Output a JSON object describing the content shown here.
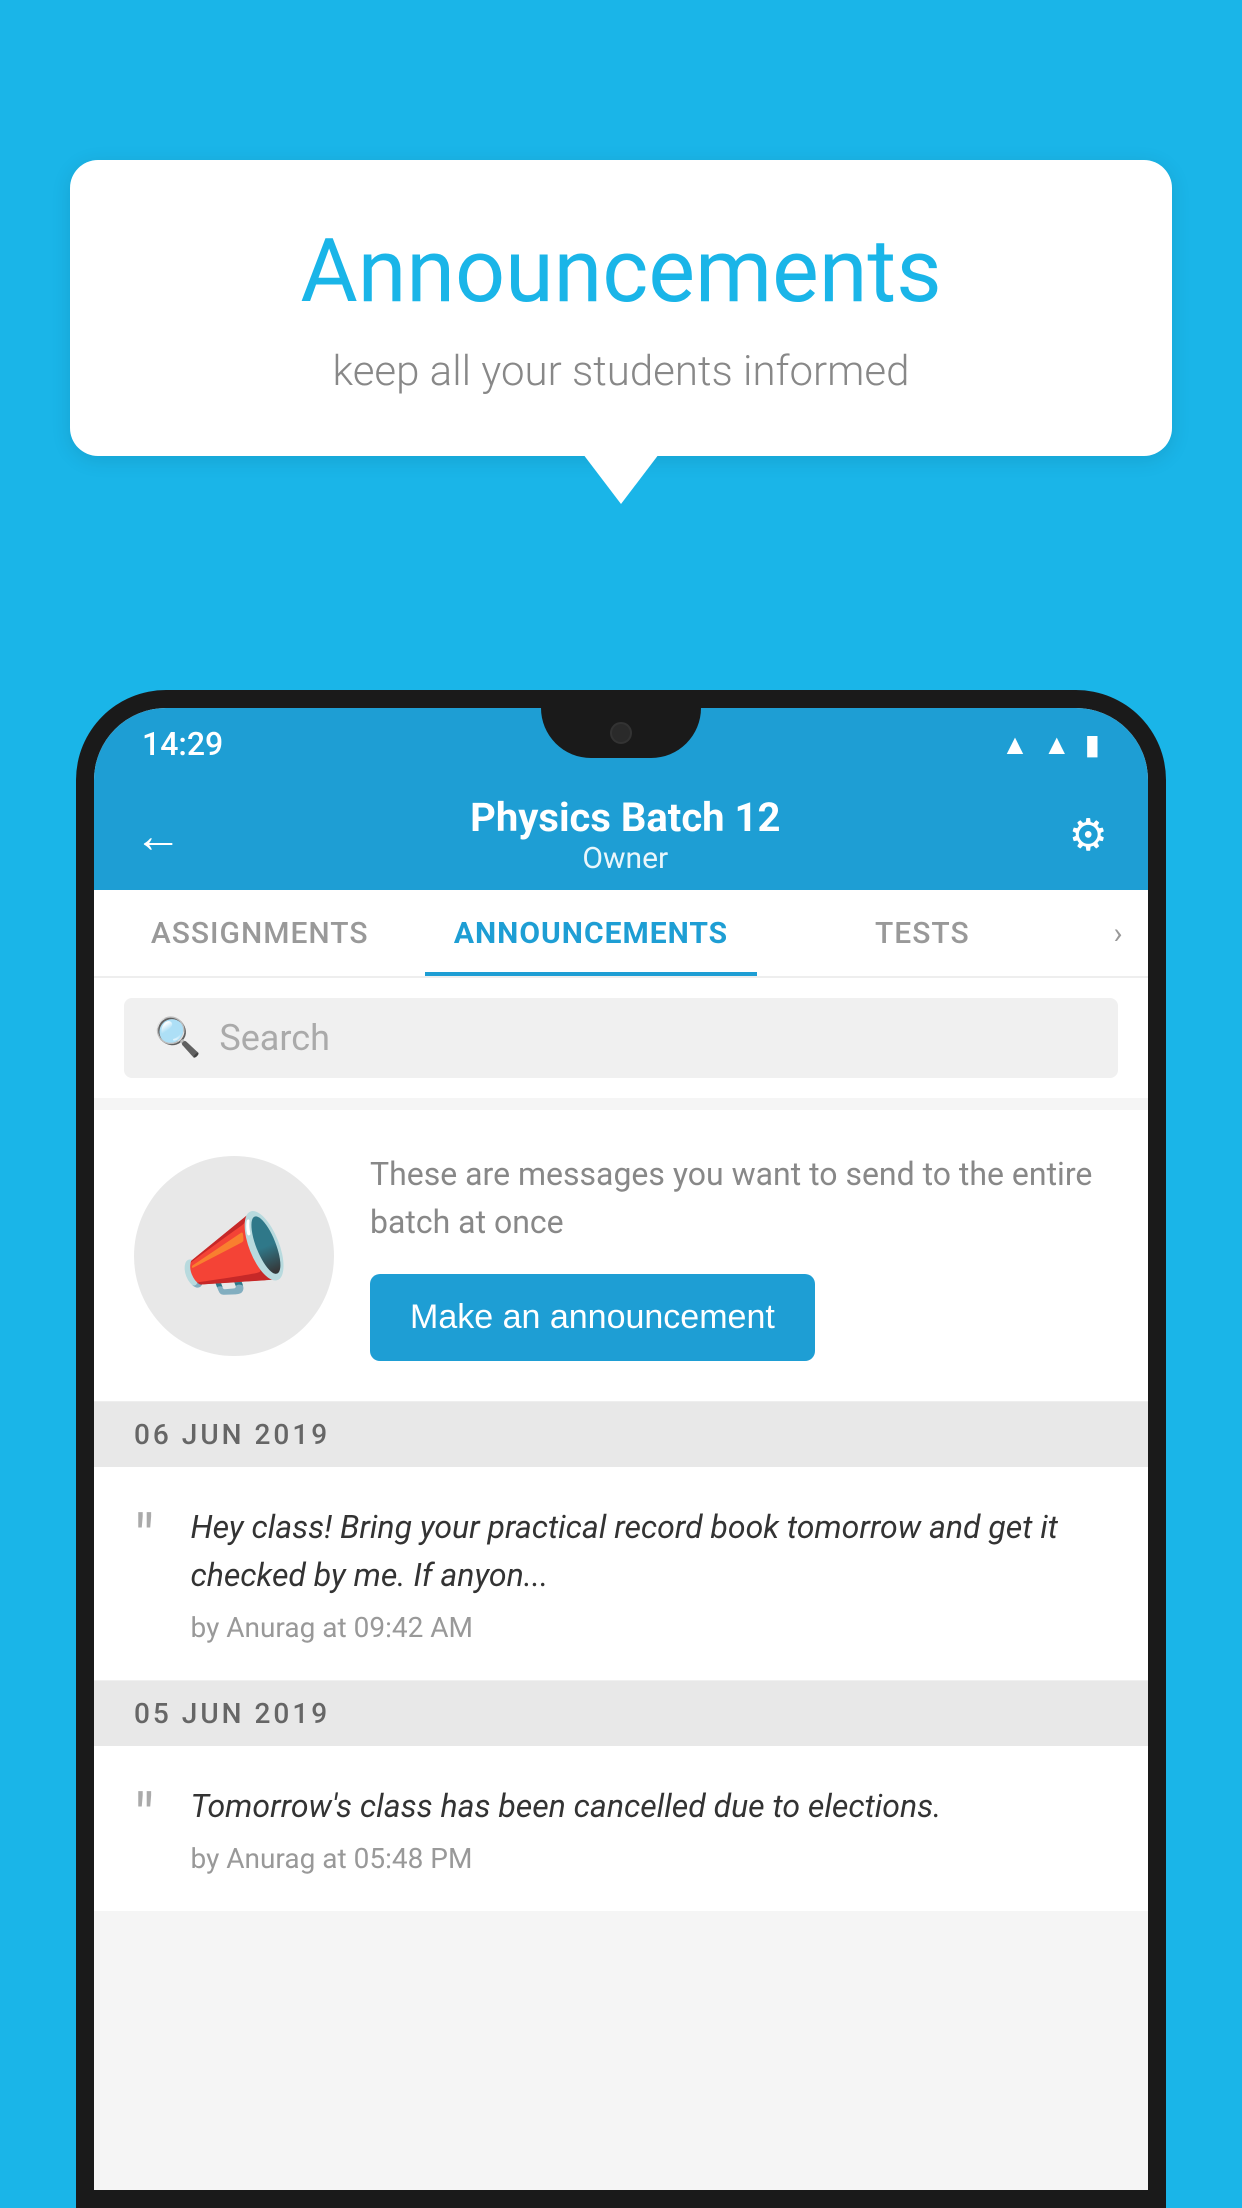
{
  "background_color": "#1ab5e8",
  "speech_bubble": {
    "title": "Announcements",
    "subtitle": "keep all your students informed"
  },
  "phone": {
    "status_bar": {
      "time": "14:29",
      "icons": [
        "wifi",
        "signal",
        "battery"
      ]
    },
    "app_bar": {
      "title": "Physics Batch 12",
      "subtitle": "Owner",
      "back_label": "←",
      "settings_label": "⚙"
    },
    "tabs": [
      {
        "label": "ASSIGNMENTS",
        "active": false
      },
      {
        "label": "ANNOUNCEMENTS",
        "active": true
      },
      {
        "label": "TESTS",
        "active": false
      }
    ],
    "search": {
      "placeholder": "Search"
    },
    "promo": {
      "description_text": "These are messages you want to send to the entire batch at once",
      "button_label": "Make an announcement"
    },
    "announcements": [
      {
        "date": "06  JUN  2019",
        "text": "Hey class! Bring your practical record book tomorrow and get it checked by me. If anyon...",
        "meta": "by Anurag at 09:42 AM"
      },
      {
        "date": "05  JUN  2019",
        "text": "Tomorrow's class has been cancelled due to elections.",
        "meta": "by Anurag at 05:48 PM"
      }
    ]
  }
}
